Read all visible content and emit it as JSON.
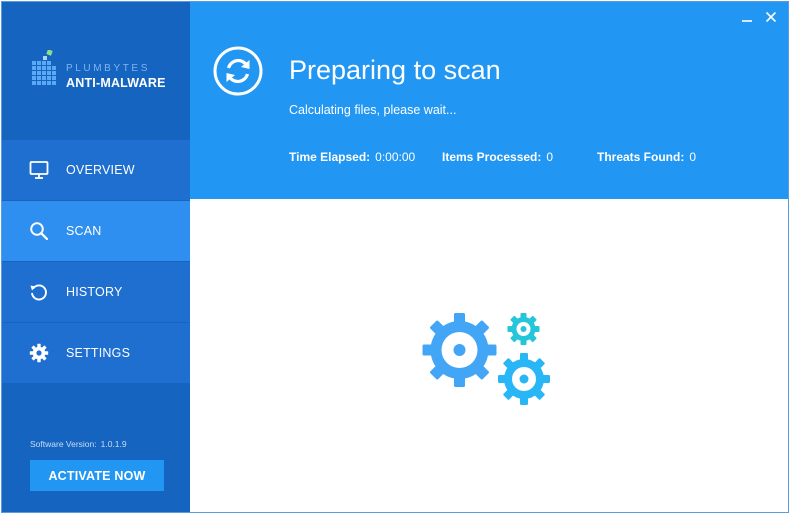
{
  "brand": {
    "name_top": "PLUMBYTES",
    "name_bottom": "ANTI-MALWARE",
    "logo_icon": "plumbytes-grid-logo"
  },
  "sidebar": {
    "items": [
      {
        "label": "OVERVIEW",
        "icon": "monitor-icon",
        "active": false
      },
      {
        "label": "SCAN",
        "icon": "search-icon",
        "active": true
      },
      {
        "label": "HISTORY",
        "icon": "history-icon",
        "active": false
      },
      {
        "label": "SETTINGS",
        "icon": "gear-icon",
        "active": false
      }
    ],
    "version_label": "Software Version:",
    "version_value": "1.0.1.9",
    "activate_label": "ACTIVATE NOW"
  },
  "header": {
    "title": "Preparing to scan",
    "subtitle": "Calculating files, please wait...",
    "stats": [
      {
        "label": "Time Elapsed:",
        "value": "0:00:00"
      },
      {
        "label": "Items Processed:",
        "value": "0"
      },
      {
        "label": "Threats Found:",
        "value": "0"
      }
    ],
    "status_icon": "refresh-icon"
  },
  "window_controls": {
    "minimize_icon": "minimize-icon",
    "close_icon": "close-icon"
  },
  "content": {
    "illustration": "gears-icon"
  },
  "colors": {
    "sidebar_bg": "#1565c0",
    "sidebar_item_bg": "#1e6fd0",
    "sidebar_active_bg": "#2f8ff0",
    "header_bg": "#2196f3",
    "activate_bg": "#2196f3",
    "gear_blue": "#42a5f5",
    "gear_cyan": "#26c6da"
  }
}
